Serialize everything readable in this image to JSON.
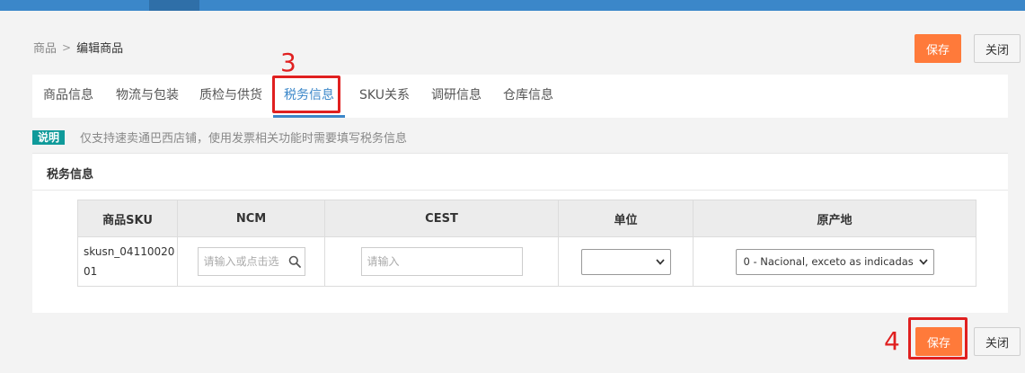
{
  "breadcrumb": {
    "parent": "商品",
    "separator": ">",
    "current": "编辑商品"
  },
  "toolbar": {
    "save_label": "保存",
    "close_label": "关闭"
  },
  "tabs": [
    {
      "label": "商品信息"
    },
    {
      "label": "物流与包装"
    },
    {
      "label": "质检与供货"
    },
    {
      "label": "税务信息",
      "active": true
    },
    {
      "label": "SKU关系"
    },
    {
      "label": "调研信息"
    },
    {
      "label": "仓库信息"
    }
  ],
  "annotations": {
    "step3": "3",
    "step4": "4"
  },
  "notice": {
    "tag": "说明",
    "text": "仅支持速卖通巴西店铺，使用发票相关功能时需要填写税务信息"
  },
  "panel": {
    "title": "税务信息"
  },
  "table": {
    "headers": [
      "商品SKU",
      "NCM",
      "CEST",
      "单位",
      "原产地"
    ],
    "rows": [
      {
        "sku": "skusn_0411002001",
        "ncm_placeholder": "请输入或点击选择",
        "cest_placeholder": "请输入",
        "unit_value": "",
        "origin_value": "0 - Nacional, exceto as indicadas"
      }
    ]
  },
  "colors": {
    "accent": "#3b87c9",
    "save": "#ff7a3a",
    "annotation": "#e02020",
    "tag": "#0f9a9a"
  }
}
